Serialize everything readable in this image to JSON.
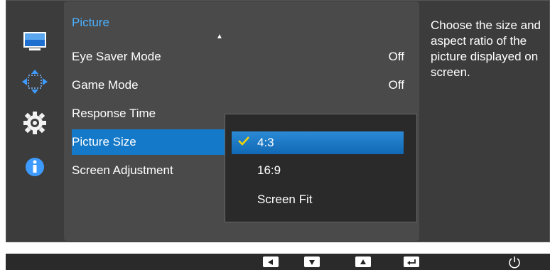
{
  "menu": {
    "title": "Picture",
    "items": [
      {
        "label": "Eye Saver Mode",
        "value": "Off"
      },
      {
        "label": "Game Mode",
        "value": "Off"
      },
      {
        "label": "Response Time",
        "value": ""
      },
      {
        "label": "Picture Size",
        "value": ""
      },
      {
        "label": "Screen Adjustment",
        "value": ""
      }
    ],
    "selected_index": 3
  },
  "submenu": {
    "options": [
      "4:3",
      "16:9",
      "Screen Fit"
    ],
    "selected_option": "4:3"
  },
  "help_text": "Choose the size and aspect ratio of the picture displayed on screen.",
  "sidebar": {
    "icons": [
      "monitor-icon",
      "resize-arrows-icon",
      "gear-icon",
      "info-icon"
    ]
  },
  "bottom_bar": {
    "buttons": [
      "left-arrow-icon",
      "down-arrow-icon",
      "up-arrow-icon",
      "enter-icon",
      "power-icon"
    ]
  },
  "colors": {
    "accent": "#1479c8",
    "title": "#4ab0ff",
    "check": "#f2d40a"
  }
}
